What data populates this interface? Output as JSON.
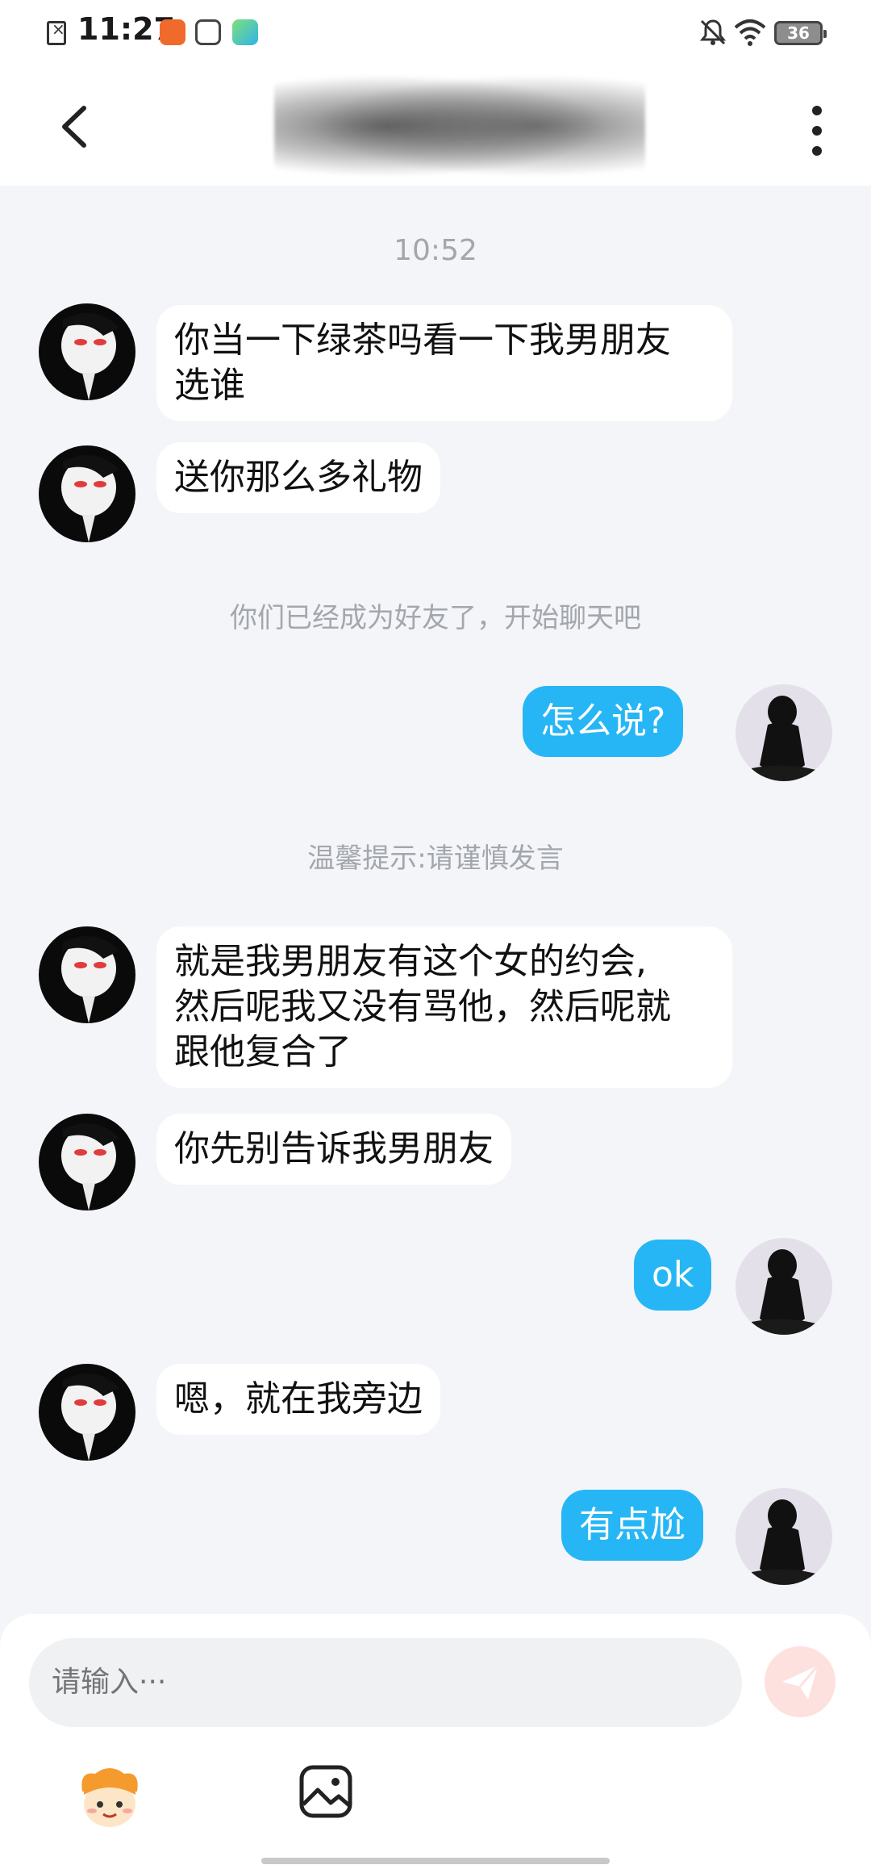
{
  "status_bar": {
    "time": "11:27",
    "battery": "36",
    "icons": [
      "sim-off-icon",
      "app-icon-1",
      "app-icon-2",
      "app-icon-3",
      "bell-off-icon",
      "wifi-icon",
      "battery-icon"
    ]
  },
  "header": {
    "title": "",
    "back_icon": "chevron-left-icon",
    "more_icon": "more-vertical-icon"
  },
  "chat": {
    "timestamp": "10:52",
    "friend_notice": "你们已经成为好友了，开始聊天吧",
    "warning_notice": "温馨提示:请谨慎发言",
    "messages": [
      {
        "side": "left",
        "text_lines": [
          "你当一下绿茶吗看一下我男朋友",
          "选谁"
        ]
      },
      {
        "side": "left",
        "text_lines": [
          "送你那么多礼物"
        ]
      },
      {
        "side": "right",
        "text_lines": [
          "怎么说?"
        ]
      },
      {
        "side": "left",
        "text_lines": [
          "就是我男朋友有这个女的约会,",
          "然后呢我又没有骂他，然后呢就",
          "跟他复合了"
        ]
      },
      {
        "side": "left",
        "text_lines": [
          "你先别告诉我男朋友"
        ]
      },
      {
        "side": "right",
        "text_lines": [
          "ok"
        ]
      },
      {
        "side": "left",
        "text_lines": [
          "嗯，就在我旁边"
        ]
      },
      {
        "side": "right",
        "text_lines": [
          "有点尬"
        ]
      }
    ]
  },
  "composer": {
    "placeholder": "请输入···",
    "send_icon": "send-icon",
    "emoji_icon": "emoji-icon",
    "image_icon": "image-icon"
  },
  "colors": {
    "accent_blue": "#27b6f5",
    "background": "#f3f5f8",
    "send_button": "#fde1de"
  }
}
